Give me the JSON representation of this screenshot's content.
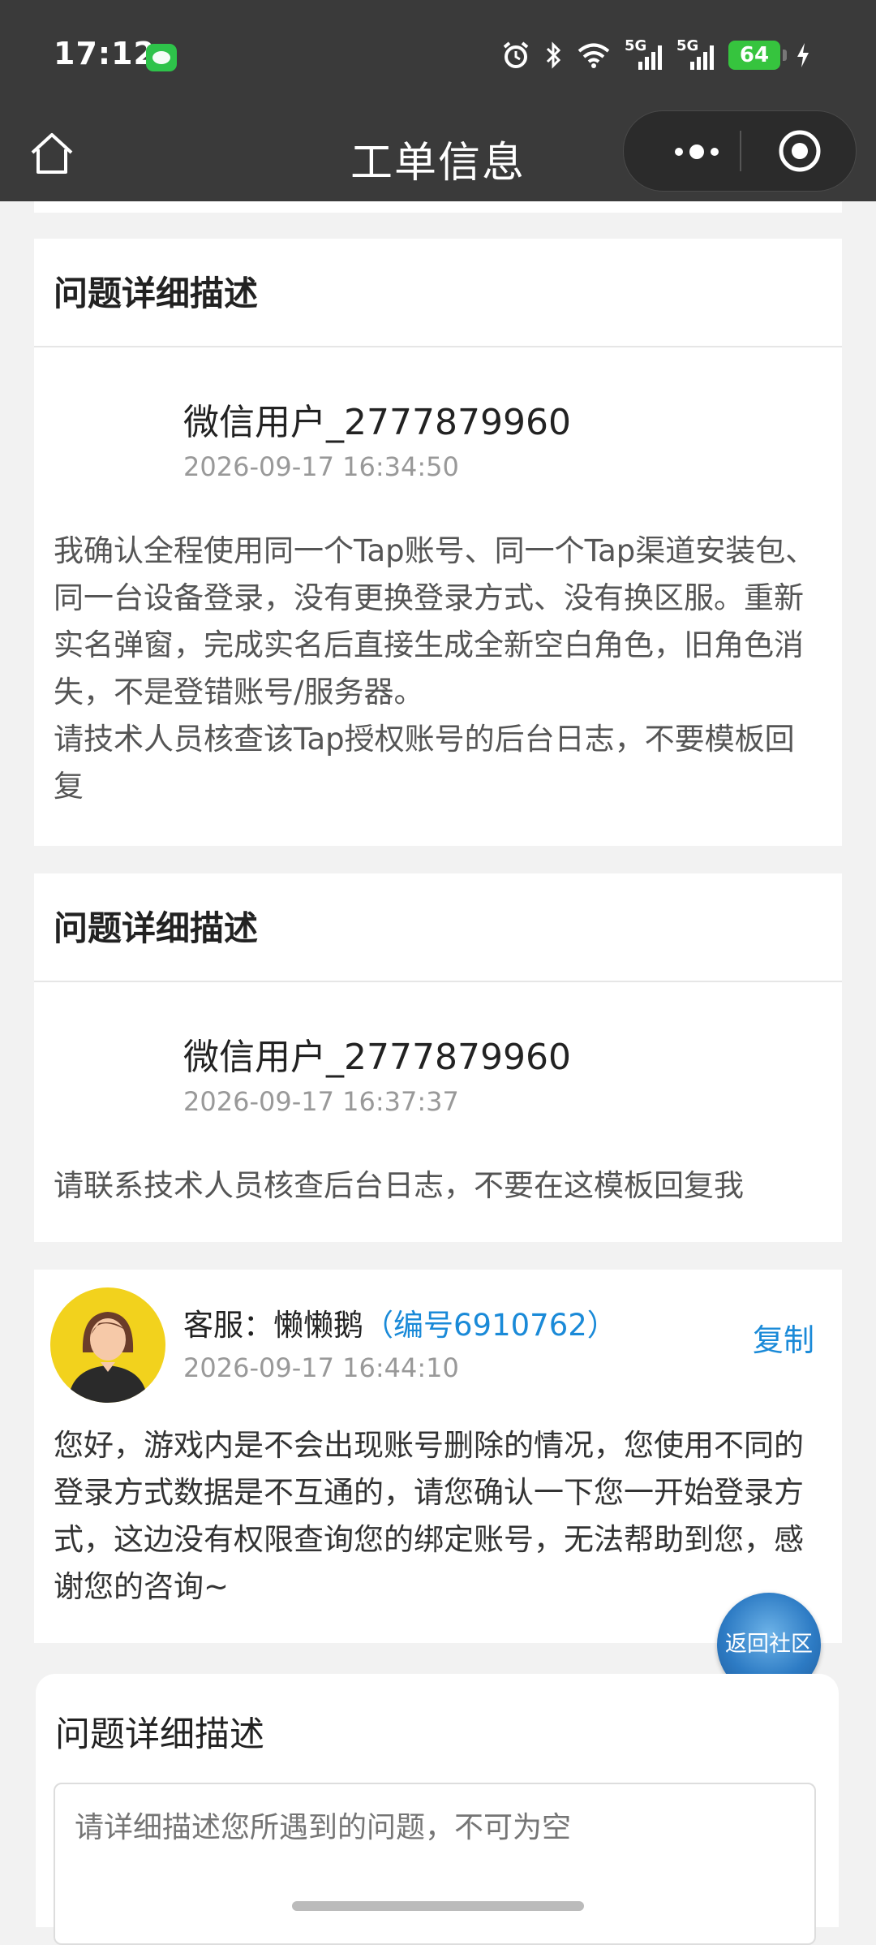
{
  "status_bar": {
    "time": "17:12",
    "net1": "5G",
    "net2": "5G",
    "battery": "64"
  },
  "title_bar": {
    "title": "工单信息"
  },
  "sections": [
    {
      "heading": "问题详细描述",
      "user": "微信用户_2777879960",
      "time": "2026-09-17 16:34:50",
      "body": "我确认全程使用同一个Tap账号、同一个Tap渠道安装包、同一台设备登录，没有更换登录方式、没有换区服。重新实名弹窗，完成实名后直接生成全新空白角色，旧角色消失，不是登错账号/服务器。\n请技术人员核查该Tap授权账号的后台日志，不要模板回复"
    },
    {
      "heading": "问题详细描述",
      "user": "微信用户_2777879960",
      "time": "2026-09-17 16:37:37",
      "body": "请联系技术人员核查后台日志，不要在这模板回复我"
    }
  ],
  "reply": {
    "agent_prefix": "客服：懒懒鹅",
    "agent_id": "（编号6910762）",
    "time": "2026-09-17 16:44:10",
    "copy_label": "复制",
    "body": "您好，游戏内是不会出现账号删除的情况，您使用不同的登录方式数据是不互通的，请您确认一下您一开始登录方式，这边没有权限查询您的绑定账号，无法帮助到您，感谢您的咨询~"
  },
  "floating": {
    "back_label": "返回社区"
  },
  "form": {
    "label": "问题详细描述",
    "placeholder": "请详细描述您所遇到的问题，不可为空"
  },
  "colors": {
    "header_bg": "#3a3a3a",
    "link_blue": "#1a8ad8",
    "avatar_bg": "#f2d21d"
  }
}
